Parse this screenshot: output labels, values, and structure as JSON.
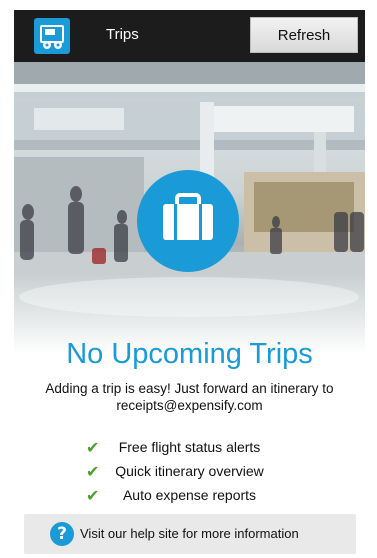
{
  "header": {
    "app_icon": "expensify-receipt-icon",
    "title": "Trips",
    "refresh_label": "Refresh"
  },
  "hero": {
    "background": "airport-terminal-photo",
    "icon": "suitcase-icon"
  },
  "empty_state": {
    "headline": "No Upcoming Trips",
    "description": "Adding a trip is easy! Just forward an itinerary to receipts@expensify.com"
  },
  "features": [
    {
      "icon": "checkmark-icon",
      "label": "Free flight status alerts"
    },
    {
      "icon": "checkmark-icon",
      "label": "Quick itinerary overview"
    },
    {
      "icon": "checkmark-icon",
      "label": "Auto expense reports"
    }
  ],
  "help": {
    "icon": "help-question-icon",
    "label": "Visit our help site for more information"
  },
  "colors": {
    "accent": "#1a9ad6",
    "topbar": "#1c1c1c",
    "check": "#4aa329"
  }
}
